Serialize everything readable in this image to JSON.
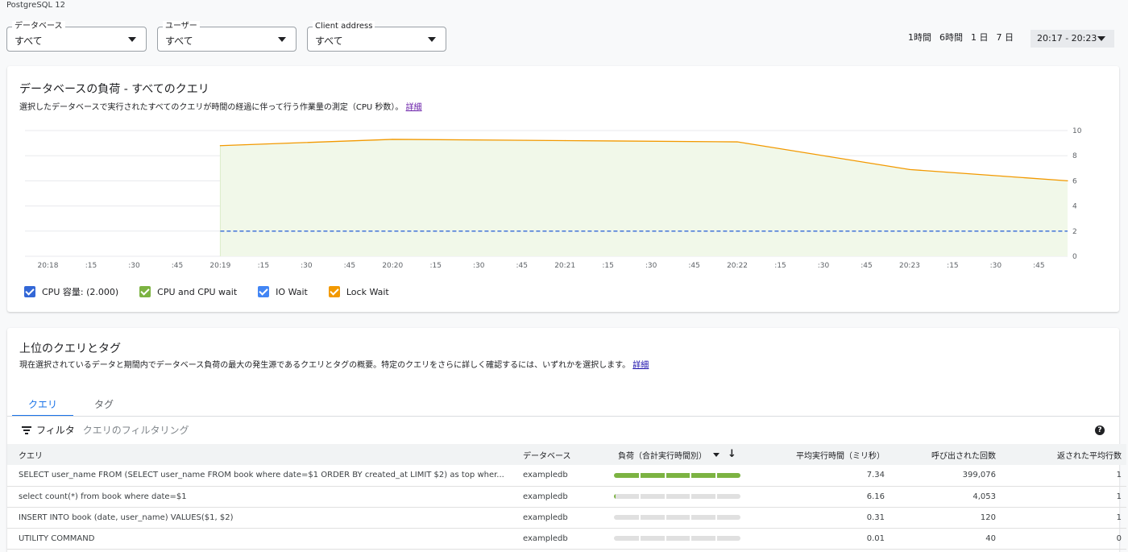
{
  "db_instance": "PostgreSQL 12",
  "filters": [
    {
      "label": "データベース",
      "value": "すべて"
    },
    {
      "label": "ユーザー",
      "value": "すべて"
    },
    {
      "label": "Client address",
      "value": "すべて"
    }
  ],
  "time_options": [
    "1時間",
    "6時間",
    "1 日",
    "7 日"
  ],
  "time_range": "20:17 - 20:23",
  "load_card": {
    "title": "データベースの負荷 - すべてのクエリ",
    "subtitle": "選択したデータベースで実行されたすべてのクエリが時間の経過に伴って行う作業量の測定（CPU 秒数）。",
    "learn_more": "詳細"
  },
  "chart_data": {
    "type": "area",
    "x_tick_labels": [
      "20:18",
      ":15",
      ":30",
      ":45",
      "20:19",
      ":15",
      ":30",
      ":45",
      "20:20",
      ":15",
      ":30",
      ":45",
      "20:21",
      ":15",
      ":30",
      ":45",
      "20:22",
      ":15",
      ":30",
      ":45",
      "20:23",
      ":15",
      ":30",
      ":45"
    ],
    "y_ticks": [
      0,
      2,
      4,
      6,
      8,
      10
    ],
    "ylim": [
      0,
      10
    ],
    "x_range": [
      "20:17:52",
      "20:23:55"
    ],
    "grid": true,
    "series": [
      {
        "name": "CPU and CPU wait",
        "color": "#7cb342",
        "x": [
          "20:19",
          "20:20",
          "20:21",
          "20:22",
          "20:23",
          "20:23:55"
        ],
        "values": [
          8.8,
          9.3,
          9.2,
          9.1,
          6.9,
          6.0
        ]
      },
      {
        "name": "CPU 容量: (2.000)",
        "color": "#3367d6",
        "style": "dashed",
        "x": [
          "20:19",
          "20:23:55"
        ],
        "values": [
          2.0,
          2.0
        ]
      }
    ],
    "legend": [
      {
        "label": "CPU 容量: (2.000)",
        "color": "#3367d6"
      },
      {
        "label": "CPU and CPU wait",
        "color": "#7cb342"
      },
      {
        "label": "IO Wait",
        "color": "#4285f4"
      },
      {
        "label": "Lock Wait",
        "color": "#f29900"
      }
    ]
  },
  "queries_card": {
    "title": "上位のクエリとタグ",
    "subtitle": "現在選択されているデータと期間内でデータベース負荷の最大の発生源であるクエリとタグの概要。特定のクエリをさらに詳しく確認するには、いずれかを選択します。",
    "learn_more": "詳細",
    "tabs": [
      "クエリ",
      "タグ"
    ],
    "filter_label": "フィルタ",
    "filter_placeholder": "クエリのフィルタリング",
    "help_glyph": "?",
    "columns": [
      "クエリ",
      "データベース",
      "負荷（合計実行時間別）",
      "平均実行時間（ミリ秒）",
      "呼び出された回数",
      "返された平均行数"
    ],
    "rows": [
      {
        "query": "SELECT user_name FROM (SELECT user_name FROM book where date=$1 ORDER BY created_at LIMIT $2) as top wher...",
        "database": "exampledb",
        "load": 1.0,
        "avg_time": "7.34",
        "calls": "399,076",
        "rows": "1"
      },
      {
        "query": "select count(*) from book where date=$1",
        "database": "exampledb",
        "load": 0.01,
        "avg_time": "6.16",
        "calls": "4,053",
        "rows": "1"
      },
      {
        "query": "INSERT INTO book (date, user_name) VALUES($1, $2)",
        "database": "exampledb",
        "load": 0.0,
        "avg_time": "0.31",
        "calls": "120",
        "rows": "1"
      },
      {
        "query": "UTILITY COMMAND",
        "database": "exampledb",
        "load": 0.0,
        "avg_time": "0.01",
        "calls": "40",
        "rows": "0"
      }
    ]
  }
}
